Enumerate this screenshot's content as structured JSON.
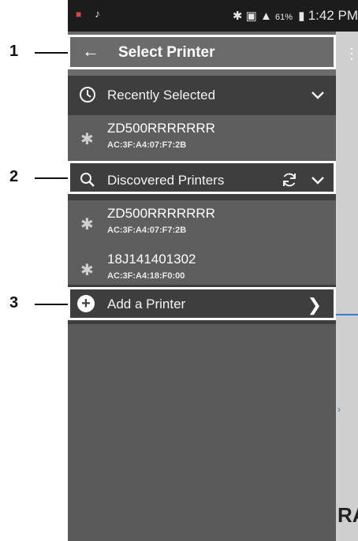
{
  "status_bar": {
    "battery": "61%",
    "time": "1:42 PM"
  },
  "toolbar": {
    "title": "Select Printer"
  },
  "recent": {
    "label": "Recently Selected",
    "printers": [
      {
        "name": "ZD500RRRRRRR",
        "mac": "AC:3F:A4:07:F7:2B"
      }
    ]
  },
  "discovered": {
    "label": "Discovered Printers",
    "printers": [
      {
        "name": "ZD500RRRRRRR",
        "mac": "AC:3F:A4:07:F7:2B"
      },
      {
        "name": "18J141401302",
        "mac": "AC:3F:A4:18:F0:00"
      }
    ]
  },
  "add": {
    "label": "Add a Printer"
  },
  "callouts": [
    "1",
    "2",
    "3"
  ],
  "background_text": "RA",
  "icons": {
    "back": "back-arrow-icon",
    "clock": "clock-icon",
    "chevron": "chevron-down-icon",
    "bluetooth": "bluetooth-icon",
    "search": "search-icon",
    "refresh": "refresh-icon",
    "add": "plus-circle-icon",
    "next": "chevron-right-icon",
    "menu": "kebab-menu-icon"
  }
}
